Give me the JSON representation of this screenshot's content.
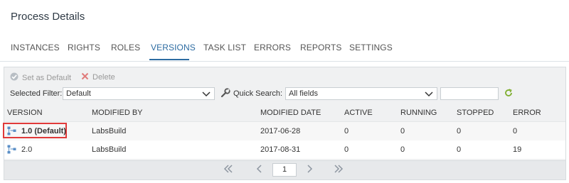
{
  "page": {
    "title": "Process Details"
  },
  "tabs": [
    {
      "label": "INSTANCES",
      "active": false
    },
    {
      "label": "RIGHTS",
      "active": false
    },
    {
      "label": "ROLES",
      "active": false
    },
    {
      "label": "VERSIONS",
      "active": true
    },
    {
      "label": "TASK LIST",
      "active": false
    },
    {
      "label": "ERRORS",
      "active": false
    },
    {
      "label": "REPORTS",
      "active": false
    },
    {
      "label": "SETTINGS",
      "active": false
    }
  ],
  "toolbar": {
    "set_default_label": "Set as Default",
    "delete_label": "Delete",
    "set_default_icon": "check-icon",
    "delete_icon": "close-icon"
  },
  "filter": {
    "selected_filter_label": "Selected Filter:",
    "selected_filter_value": "Default",
    "quick_search_label": "Quick Search:",
    "quick_search_value": "All fields",
    "search_text": ""
  },
  "table": {
    "headers": [
      "VERSION",
      "MODIFIED BY",
      "MODIFIED DATE",
      "ACTIVE",
      "RUNNING",
      "STOPPED",
      "ERROR"
    ],
    "rows": [
      {
        "version": "1.0 (Default)",
        "modified_by": "LabsBuild",
        "modified_date": "2017-06-28",
        "active": "0",
        "running": "0",
        "stopped": "0",
        "error": "0"
      },
      {
        "version": "2.0",
        "modified_by": "LabsBuild",
        "modified_date": "2017-08-31",
        "active": "0",
        "running": "0",
        "stopped": "0",
        "error": "19"
      }
    ]
  },
  "pagination": {
    "current_page": "1"
  },
  "colors": {
    "accent": "#2d6ca2",
    "highlight": "#e03a3a",
    "refresh": "#7fae2f"
  }
}
